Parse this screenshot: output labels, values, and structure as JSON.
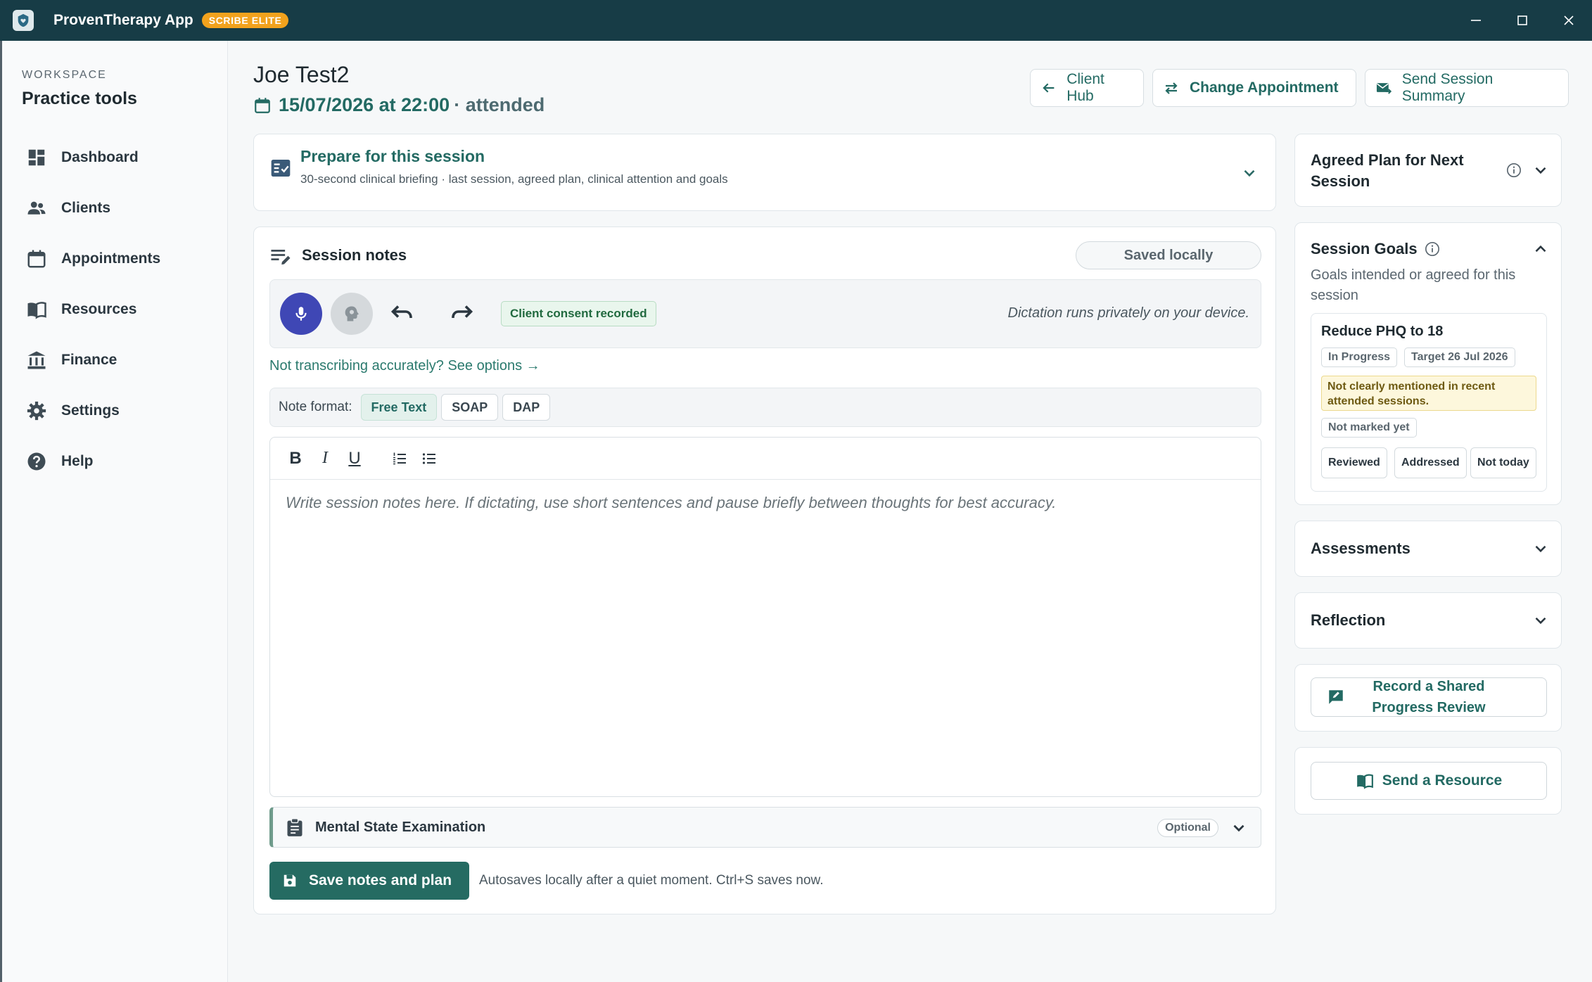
{
  "titlebar": {
    "app_title": "ProvenTherapy App",
    "badge": "SCRIBE ELITE"
  },
  "sidebar": {
    "workspace_label": "WORKSPACE",
    "workspace_title": "Practice tools",
    "items": [
      {
        "label": "Dashboard",
        "icon": "dashboard-icon"
      },
      {
        "label": "Clients",
        "icon": "people-icon"
      },
      {
        "label": "Appointments",
        "icon": "calendar-icon"
      },
      {
        "label": "Resources",
        "icon": "book-icon"
      },
      {
        "label": "Finance",
        "icon": "bank-icon"
      },
      {
        "label": "Settings",
        "icon": "gear-icon"
      },
      {
        "label": "Help",
        "icon": "help-icon"
      }
    ]
  },
  "header": {
    "client_name": "Joe Test2",
    "appointment_date": "15/07/2026 at 22:00",
    "appointment_status": "· attended",
    "buttons": {
      "client_hub": "Client Hub",
      "change_appointment": "Change Appointment",
      "send_summary": "Send Session Summary"
    }
  },
  "prepare": {
    "title": "Prepare for this session",
    "subtitle": "30-second clinical briefing · last session, agreed plan, clinical attention and goals"
  },
  "notes": {
    "title": "Session notes",
    "saved_status": "Saved locally",
    "consent": "Client consent recorded",
    "dictation_note": "Dictation runs privately on your device.",
    "transcribe_link": "Not transcribing accurately? See options →",
    "format_label": "Note format:",
    "formats": [
      "Free Text",
      "SOAP",
      "DAP"
    ],
    "active_format": "Free Text",
    "toolbar": {
      "bold": "B",
      "italic": "I",
      "underline": "U"
    },
    "placeholder": "Write session notes here. If dictating, use short sentences and pause briefly between thoughts for best accuracy.",
    "mse_title": "Mental State Examination",
    "mse_tag": "Optional",
    "save_label": "Save notes and plan",
    "autosave_note": "Autosaves locally after a quiet moment. Ctrl+S saves now."
  },
  "right": {
    "agreed_plan_title": "Agreed Plan for Next Session",
    "goals": {
      "title": "Session Goals",
      "subtitle": "Goals intended or agreed for this session",
      "goal_title": "Reduce PHQ to 18",
      "status": "In Progress",
      "target": "Target 26 Jul 2026",
      "warning": "Not clearly mentioned in recent attended sessions.",
      "marked": "Not marked yet",
      "actions": [
        "Reviewed",
        "Addressed",
        "Not today"
      ]
    },
    "assessments_title": "Assessments",
    "reflection_title": "Reflection",
    "progress_review_label": "Record a Shared Progress Review",
    "send_resource_label": "Send a Resource"
  },
  "colors": {
    "titlebar": "#173c46",
    "accent": "#236a63",
    "badge": "#f2a21d",
    "mic": "#3f47b5"
  }
}
